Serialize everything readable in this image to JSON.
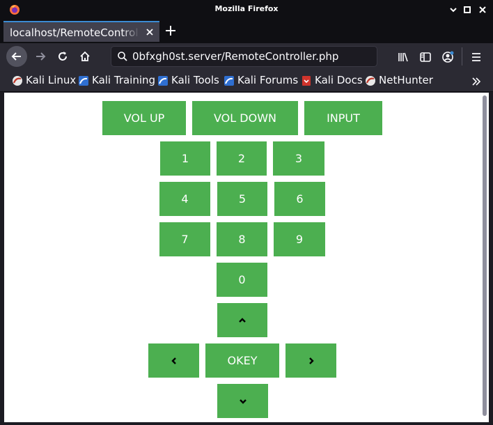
{
  "window": {
    "title": "Mozilla Firefox"
  },
  "tab": {
    "title": "localhost/RemoteController.php"
  },
  "url": "0bfxgh0st.server/RemoteController.php",
  "bookmarks": [
    {
      "label": "Kali Linux",
      "icon": "kali-icon"
    },
    {
      "label": "Kali Training",
      "icon": "kali-training-icon"
    },
    {
      "label": "Kali Tools",
      "icon": "kali-tools-icon"
    },
    {
      "label": "Kali Forums",
      "icon": "kali-forums-icon"
    },
    {
      "label": "Kali Docs",
      "icon": "kali-docs-icon"
    },
    {
      "label": "NetHunter",
      "icon": "nethunter-icon"
    }
  ],
  "remote": {
    "vol_up": "VOL UP",
    "vol_down": "VOL DOWN",
    "input": "INPUT",
    "digits": [
      "1",
      "2",
      "3",
      "4",
      "5",
      "6",
      "7",
      "8",
      "9",
      "0"
    ],
    "okey": "OKEY",
    "arrows": [
      "chevron-up-icon",
      "chevron-left-icon",
      "chevron-right-icon",
      "chevron-down-icon"
    ]
  },
  "colors": {
    "button": "#4caf50",
    "button_text": "#ffffff",
    "accent": "#3b8bd4"
  }
}
